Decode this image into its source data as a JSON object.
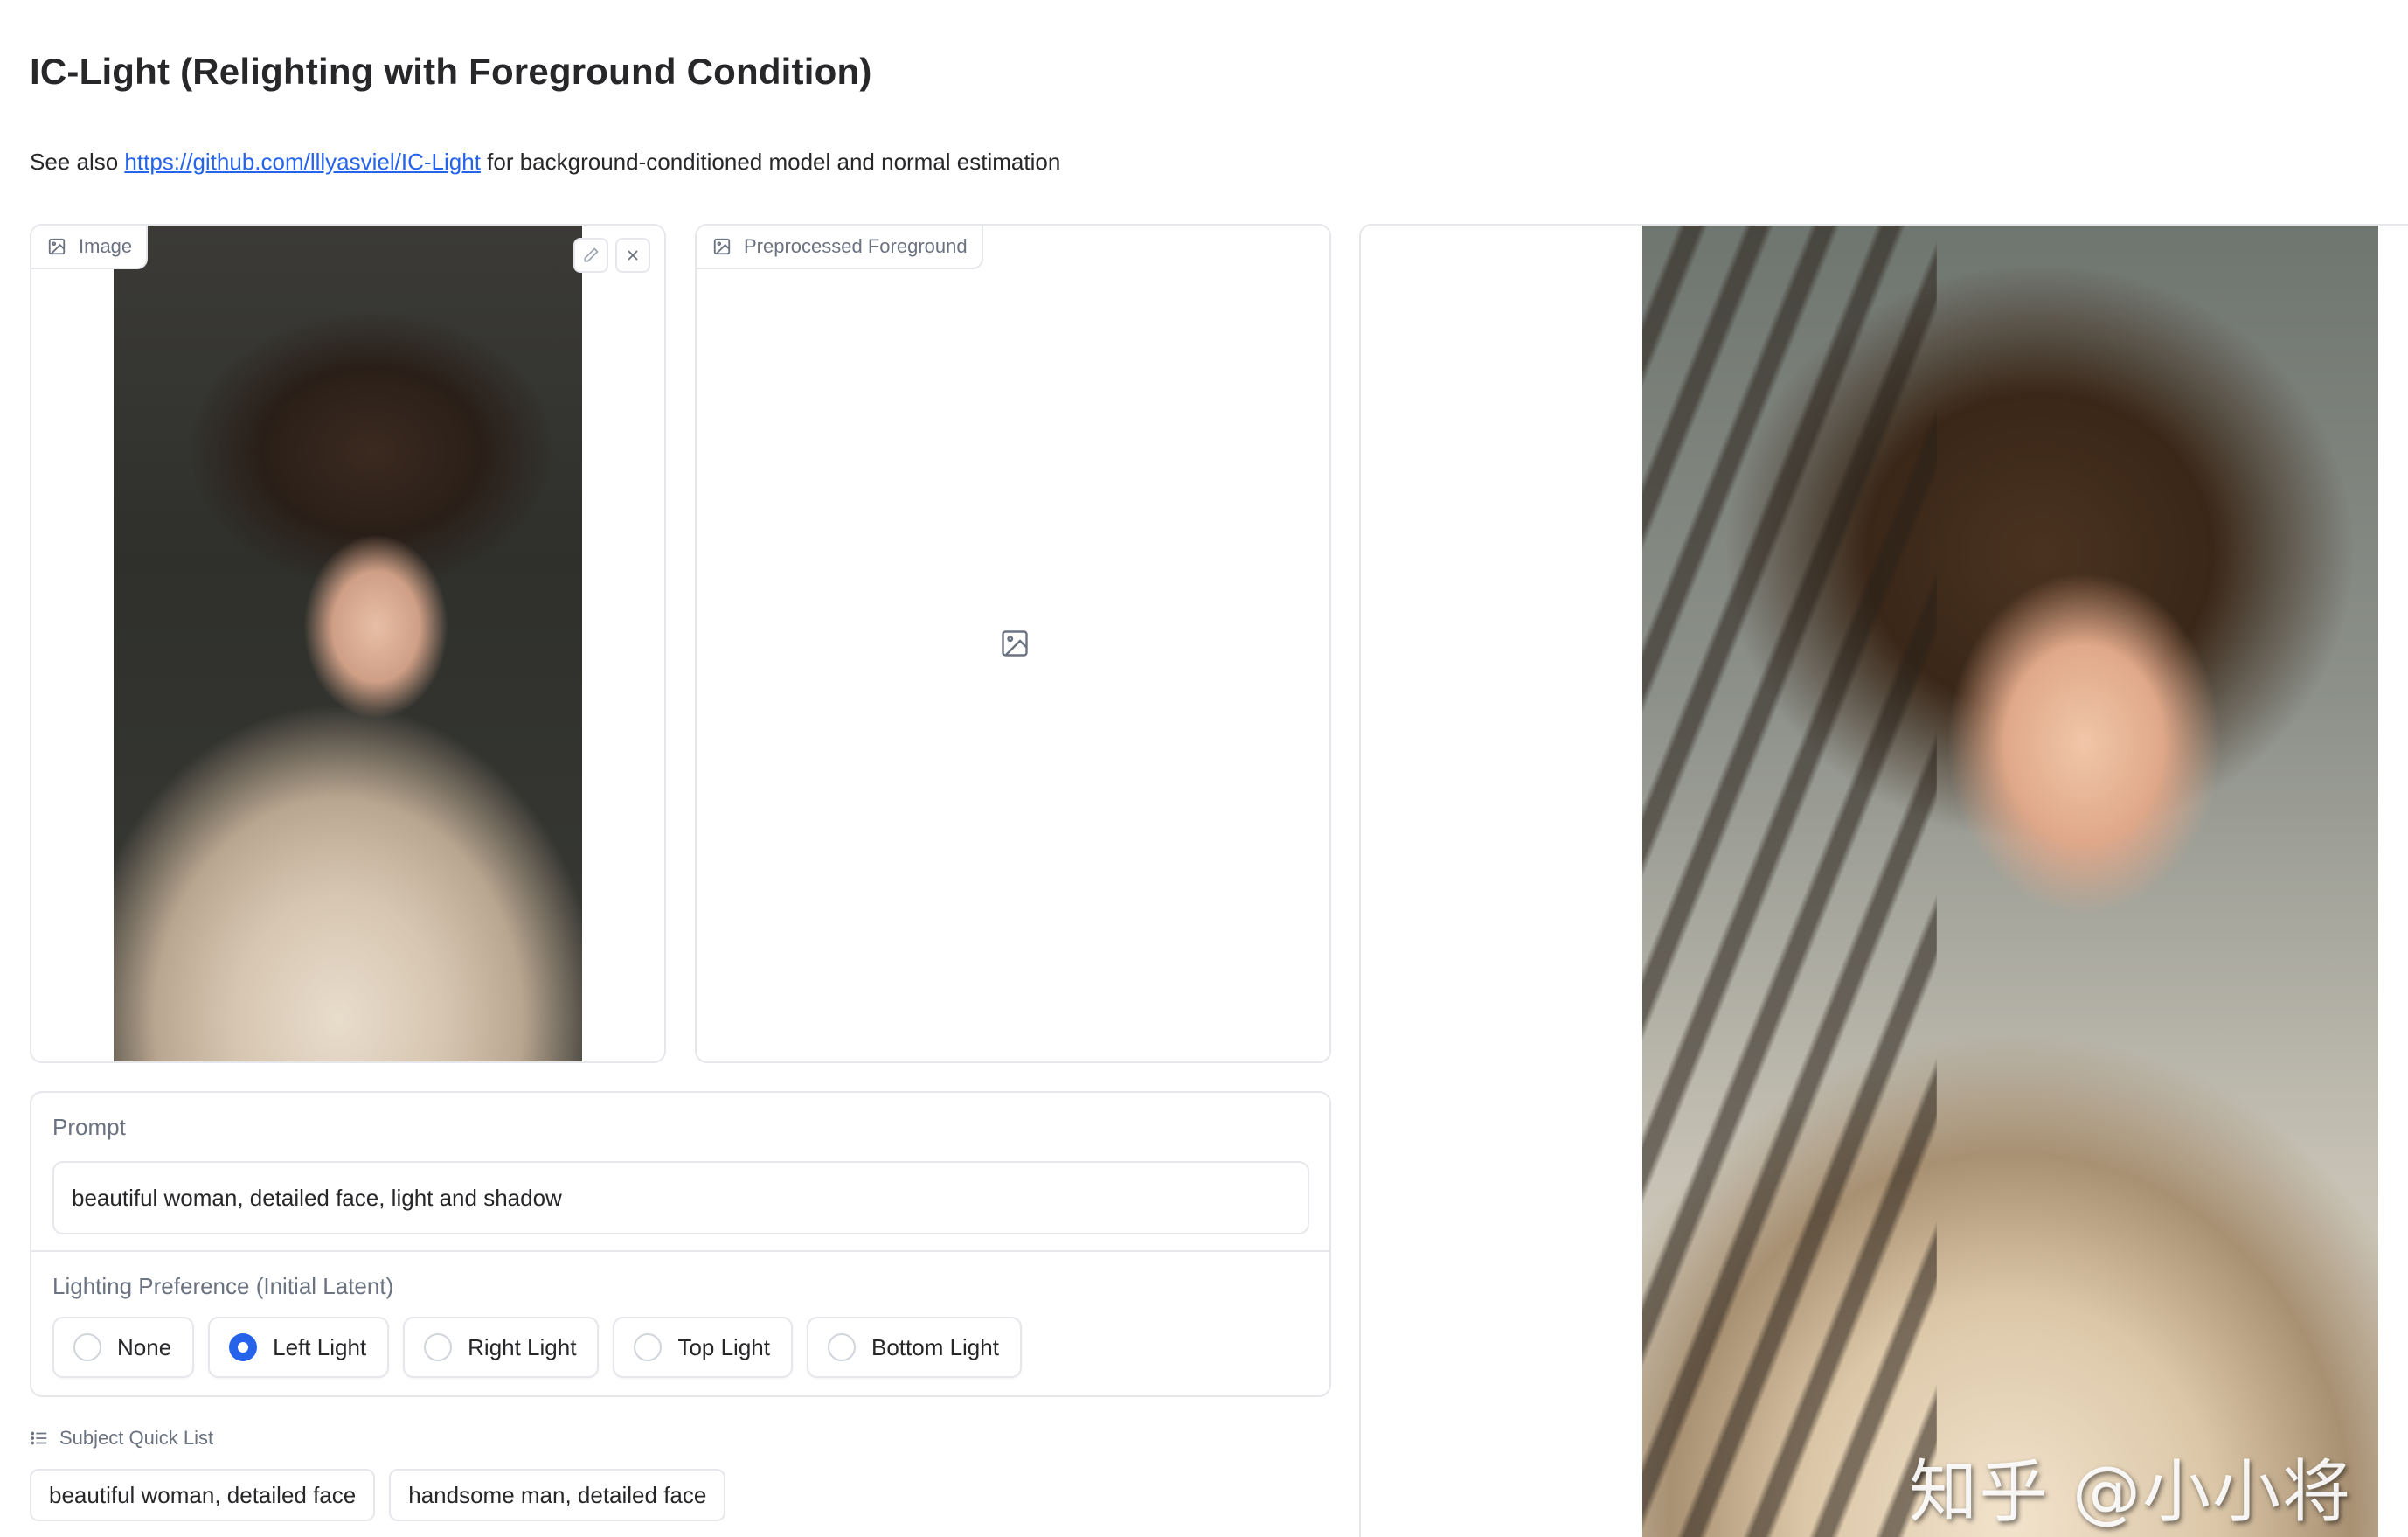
{
  "app": {
    "title": "IC-Light (Relighting with Foreground Condition)",
    "subtitle_prefix": "See also ",
    "subtitle_link": "https://github.com/lllyasviel/IC-Light",
    "subtitle_suffix": " for background-conditioned model and normal estimation"
  },
  "input_panel": {
    "label": "Image",
    "label_icon": "image-icon",
    "actions": [
      {
        "name": "edit",
        "icon": "pencil-icon"
      },
      {
        "name": "clear",
        "icon": "close-icon"
      }
    ]
  },
  "preprocessed_panel": {
    "label": "Preprocessed Foreground",
    "label_icon": "image-icon",
    "placeholder_icon": "image-placeholder-icon"
  },
  "output_panel": {
    "watermark": "知乎 @小小将"
  },
  "prompt": {
    "label": "Prompt",
    "value": "beautiful woman, detailed face, light and shadow"
  },
  "lighting": {
    "label": "Lighting Preference (Initial Latent)",
    "options": [
      {
        "label": "None",
        "checked": false
      },
      {
        "label": "Left Light",
        "checked": true
      },
      {
        "label": "Right Light",
        "checked": false
      },
      {
        "label": "Top Light",
        "checked": false
      },
      {
        "label": "Bottom Light",
        "checked": false
      }
    ],
    "accent": "#2563eb"
  },
  "quick_list": {
    "label": "Subject Quick List",
    "label_icon": "list-icon",
    "items": [
      "beautiful woman, detailed face",
      "handsome man, detailed face"
    ]
  }
}
